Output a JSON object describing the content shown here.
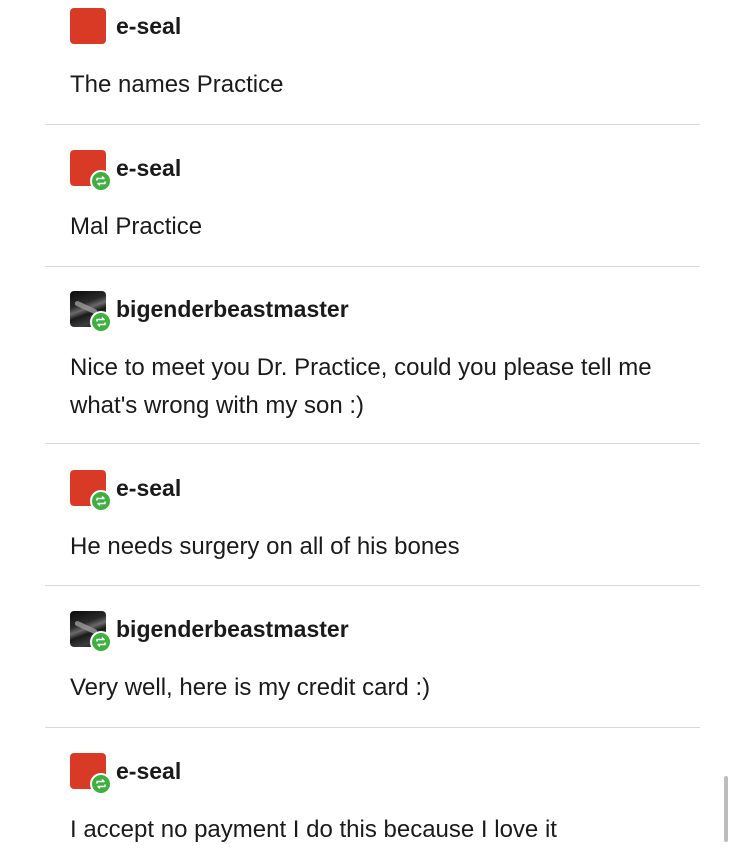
{
  "thread": [
    {
      "username": "e-seal",
      "avatar": "red-square",
      "reblog": false,
      "text": "The names Practice"
    },
    {
      "username": "e-seal",
      "avatar": "red-square",
      "reblog": true,
      "text": "Mal Practice"
    },
    {
      "username": "bigenderbeastmaster",
      "avatar": "dark-photo",
      "reblog": true,
      "text": "Nice to meet you Dr. Practice, could you please tell me what's wrong with my son :)"
    },
    {
      "username": "e-seal",
      "avatar": "red-square",
      "reblog": true,
      "text": "He needs surgery on all of his bones"
    },
    {
      "username": "bigenderbeastmaster",
      "avatar": "dark-photo",
      "reblog": true,
      "text": "Very well, here is my credit card :)"
    },
    {
      "username": "e-seal",
      "avatar": "red-square",
      "reblog": true,
      "text": "I accept no payment I do this because I love it"
    }
  ],
  "colors": {
    "avatar_red": "#d83a25",
    "reblog_green": "#3fb040",
    "divider": "#d8d8d8",
    "text": "#1a1a1a"
  },
  "icons": {
    "reblog": "reblog-icon"
  }
}
